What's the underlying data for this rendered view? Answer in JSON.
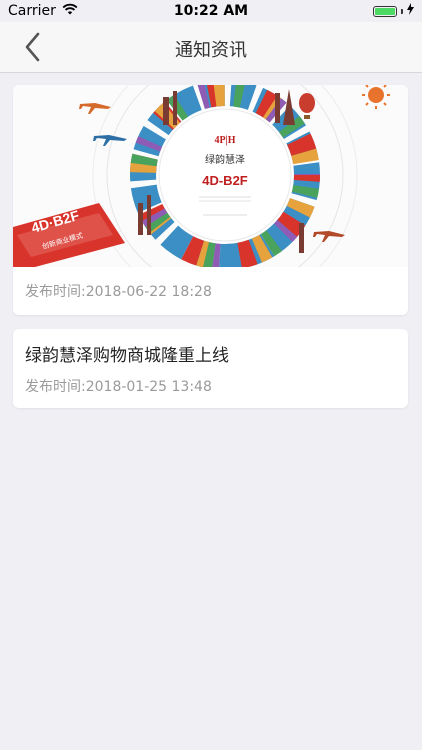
{
  "status_bar": {
    "carrier": "Carrier",
    "time": "10:22 AM",
    "battery_level": 1.0
  },
  "navbar": {
    "title": "通知资讯",
    "back_icon": "chevron-left-icon"
  },
  "articles": [
    {
      "banner": {
        "brand_text": "绿韵慧泽",
        "product_text": "4D-B2F",
        "logo_text": "4P|H",
        "badge_text": "4D·B2F",
        "badge_sub": "创新商业模式"
      },
      "date": "发布时间:2018-06-22 18:28"
    },
    {
      "title": "绿韵慧泽购物商城隆重上线",
      "date": "发布时间:2018-01-25 13:48"
    }
  ],
  "colors": {
    "background": "#efeff4",
    "accent_red": "#d9342b",
    "battery_green": "#4cd964"
  }
}
